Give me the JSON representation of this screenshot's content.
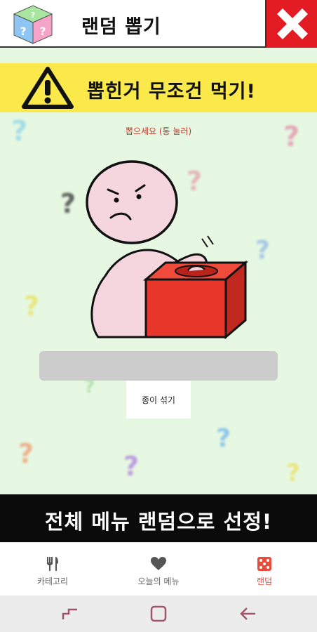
{
  "header": {
    "title": "랜덤 뽑기",
    "logo_icon": "question-dice-icon",
    "close_icon": "close-x-icon",
    "close_color": "#e31b23"
  },
  "main": {
    "background": "#e6f8e2",
    "warning": {
      "text": "뽑힌거 무조건 먹기!",
      "icon": "warning-triangle-icon",
      "background": "#fbe84a"
    },
    "hint": "뽑으세요 (통 눌러)",
    "illustration": "person-reaching-into-box",
    "result_value": "",
    "shuffle_label": "종이 섞기"
  },
  "bottom_banner": {
    "text": "전체 메뉴 랜덤으로 선정!"
  },
  "tabs": [
    {
      "label": "카테고리",
      "icon": "fork-knife-icon",
      "active": false
    },
    {
      "label": "오늘의 메뉴",
      "icon": "heart-icon",
      "active": false
    },
    {
      "label": "랜덤",
      "icon": "dice-icon",
      "active": true
    }
  ],
  "system_nav": {
    "recent": "recent-apps-icon",
    "home": "home-icon",
    "back": "back-arrow-icon"
  }
}
